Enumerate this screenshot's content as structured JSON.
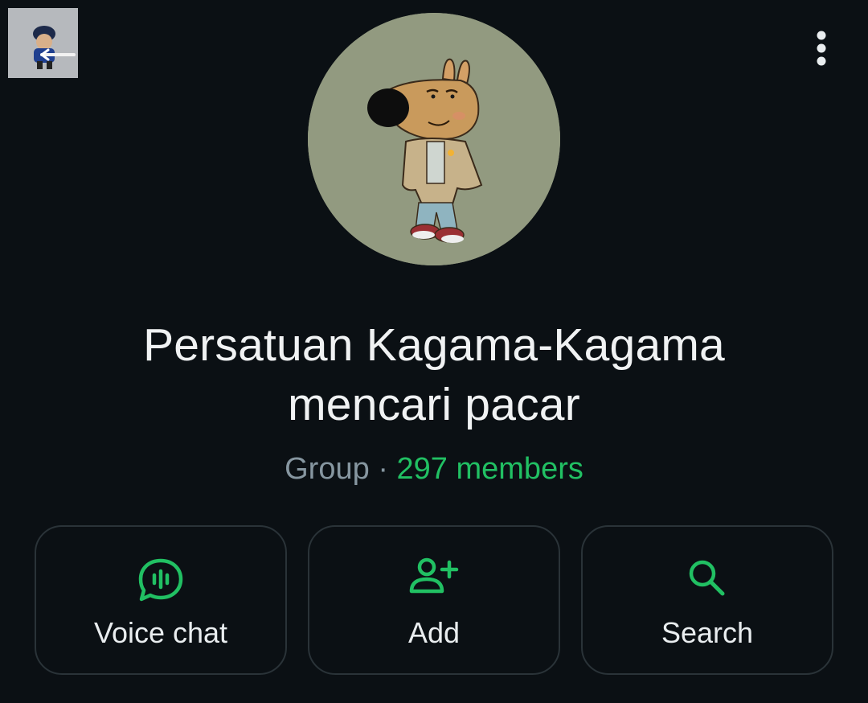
{
  "header": {
    "back_icon": "back-arrow-icon",
    "thumbnail": "user-avatar-thumbnail",
    "menu_icon": "more-vert-icon"
  },
  "group": {
    "avatar": "group-photo-cartoon-dog",
    "title_line1": "Persatuan Kagama-Kagama",
    "title_line2": "mencari pacar",
    "type": "Group",
    "separator": "·",
    "members": "297 members"
  },
  "actions": [
    {
      "label": "Voice chat",
      "icon": "voice-chat-icon"
    },
    {
      "label": "Add",
      "icon": "add-person-icon"
    },
    {
      "label": "Search",
      "icon": "search-icon"
    }
  ],
  "colors": {
    "background": "#0b1014",
    "accent": "#21c063",
    "secondary_text": "#8696a0",
    "card_border": "#2a3338"
  }
}
